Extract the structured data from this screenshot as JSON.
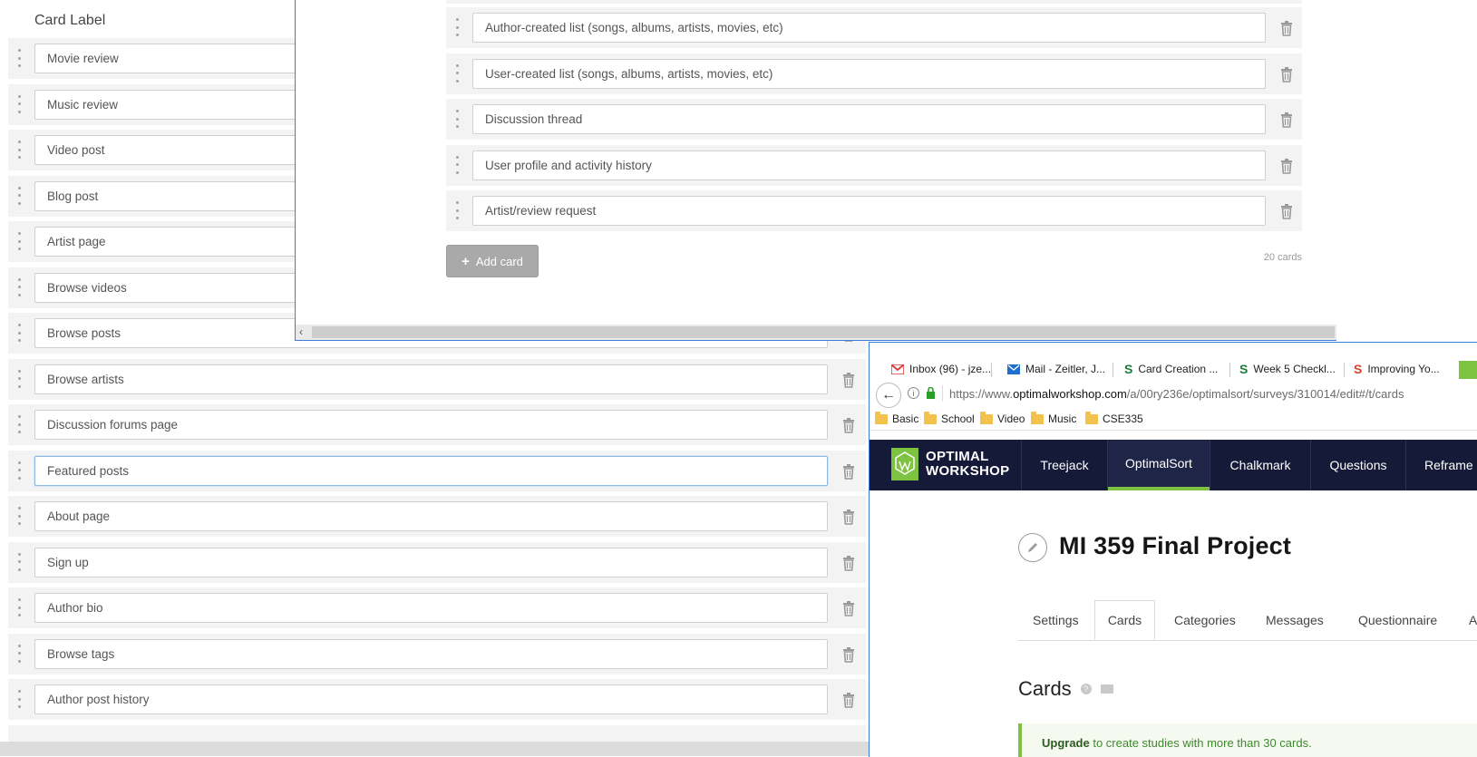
{
  "left_window": {
    "column_header": "Card Label",
    "cards": [
      "Movie review",
      "Music review",
      "Video post",
      "Blog post",
      "Artist page",
      "Browse videos",
      "Browse posts",
      "Browse artists",
      "Discussion forums page",
      "Featured posts",
      "About page",
      "Sign up",
      "Author bio",
      "Browse tags",
      "Author post history"
    ],
    "focused_card": "Featured posts"
  },
  "top_window": {
    "cards": [
      "Author-created list (songs, albums, artists, movies, etc)",
      "User-created list (songs, albums, artists, movies, etc)",
      "Discussion thread",
      "User profile and activity history",
      "Artist/review request"
    ],
    "add_card_label": "Add card",
    "card_count": "20 cards"
  },
  "browser": {
    "tabs": [
      {
        "label": "Inbox (96) - jze...",
        "icon": "gmail-icon"
      },
      {
        "label": "Mail - Zeitler, J...",
        "icon": "mail-icon"
      },
      {
        "label": "Card Creation ...",
        "icon": "s-doc-icon"
      },
      {
        "label": "Week 5 Checkl...",
        "icon": "s-doc-icon"
      },
      {
        "label": "Improving Yo...",
        "icon": "s-red-icon"
      }
    ],
    "url_prefix": "https://www.",
    "url_host": "optimalworkshop.com",
    "url_path": "/a/00ry236e/optimalsort/surveys/310014/edit#/t/cards",
    "bookmarks": [
      "Basic",
      "School",
      "Video",
      "Music",
      "CSE335"
    ],
    "logo_line1": "OPTIMAL",
    "logo_line2": "WORKSHOP",
    "nav": [
      "Treejack",
      "OptimalSort",
      "Chalkmark",
      "Questions",
      "Reframe"
    ],
    "active_nav": "OptimalSort",
    "project_title": "MI 359 Final Project",
    "subtabs": [
      "Settings",
      "Cards",
      "Categories",
      "Messages",
      "Questionnaire",
      "A"
    ],
    "active_subtab": "Cards",
    "cards_heading": "Cards",
    "upgrade_strong": "Upgrade",
    "upgrade_rest": " to create studies with more than 30 cards."
  },
  "colors": {
    "nav_bg": "#141a38",
    "accent_green": "#7ec242",
    "window_border_blue": "#3c7fd8"
  }
}
